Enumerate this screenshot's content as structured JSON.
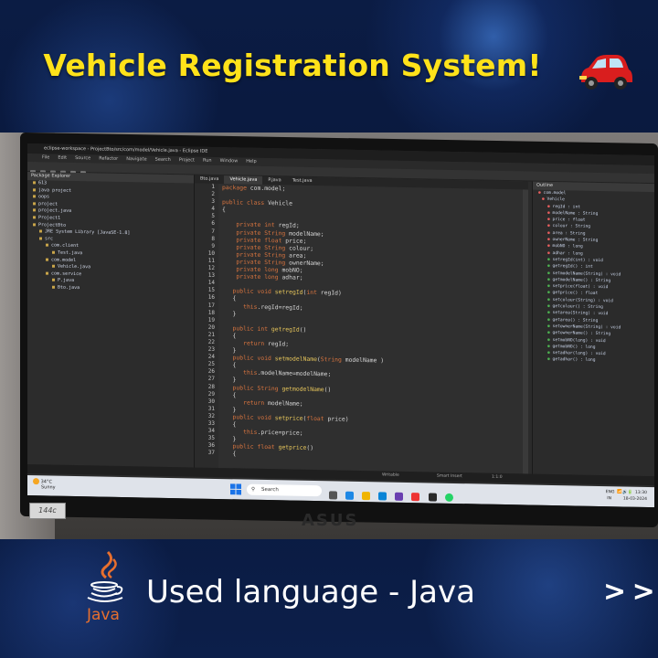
{
  "header": {
    "title": "Vehicle Registration System!",
    "emoji_icon": "car-icon"
  },
  "window": {
    "title": "eclipse-workspace - ProjectBto/src/com/model/Vehicle.java - Eclipse IDE",
    "menus": [
      "File",
      "Edit",
      "Source",
      "Refactor",
      "Navigate",
      "Search",
      "Project",
      "Run",
      "Window",
      "Help"
    ]
  },
  "package_explorer": {
    "title": "Package Explorer",
    "items": [
      "613",
      "java project",
      "oops",
      "project",
      "project.java",
      "Project1",
      "ProjectBto",
      "JRE System Library [JavaSE-1.8]",
      "src",
      "com.client",
      "Test.java",
      "com.model",
      "Vehicle.java",
      "com.service",
      "P.java",
      "Bto.java"
    ]
  },
  "editor": {
    "tabs": [
      "Bto.java",
      "Vehicle.java",
      "P.java",
      "Test.java"
    ],
    "active_tab": "Vehicle.java",
    "line_numbers": [
      "1",
      "2",
      "3",
      "4",
      "5",
      "6",
      "7",
      "8",
      "9",
      "10",
      "11",
      "12",
      "13",
      "14",
      "15",
      "16",
      "17",
      "18",
      "19",
      "20",
      "21",
      "22",
      "23",
      "24",
      "25",
      "26",
      "27",
      "28",
      "29",
      "30",
      "31",
      "32",
      "33",
      "34",
      "35",
      "36",
      "37"
    ],
    "lines": [
      "package com.model;",
      "",
      "public class Vehicle",
      "{",
      "",
      "    private int regId;",
      "    private String modelName;",
      "    private float price;",
      "    private String colour;",
      "    private String area;",
      "    private String ownerName;",
      "    private long mobNO;",
      "    private long adhar;",
      "",
      "   public void setregId(int regId)",
      "   {",
      "      this.regId=regId;",
      "   }",
      "",
      "   public int getregId()",
      "   {",
      "      return regId;",
      "   }",
      "   public void setmodelName(String modelName )",
      "   {",
      "      this.modelName=modelName;",
      "   }",
      "   public String getmodelName()",
      "   {",
      "      return modelName;",
      "   }",
      "   public void setprice(float price)",
      "   {",
      "      this.price=price;",
      "   }",
      "   public float getprice()",
      "   {"
    ]
  },
  "outline": {
    "title": "Outline",
    "items": [
      "com.model",
      "Vehicle",
      "regId : int",
      "modelName : String",
      "price : float",
      "colour : String",
      "area : String",
      "ownerName : String",
      "mobNO : long",
      "adhar : long",
      "setregId(int) : void",
      "getregId() : int",
      "setmodelName(String) : void",
      "getmodelName() : String",
      "setprice(float) : void",
      "getprice() : float",
      "setcolour(String) : void",
      "getcolour() : String",
      "setarea(String) : void",
      "getarea() : String",
      "setownerName(String) : void",
      "getownerName() : String",
      "setmobNO(long) : void",
      "getmobNO() : long",
      "setadhar(long) : void",
      "getadhar() : long"
    ]
  },
  "statusbar": {
    "mode": "Writable",
    "insert": "Smart Insert",
    "position": "1:1:0"
  },
  "taskbar": {
    "weather_temp": "34°C",
    "weather_desc": "Sunny",
    "search_placeholder": "Search",
    "lang": "ENG",
    "region": "IN",
    "time": "13:30",
    "date": "18-03-2024"
  },
  "laptop": {
    "brand": "ASUS",
    "sticker": "144c"
  },
  "footer": {
    "language_label": "Used language - Java",
    "logo_text": "Java",
    "next_label": "> >"
  },
  "colors": {
    "title_yellow": "#ffe21a",
    "background_navy": "#0a1a3c",
    "keyword": "#d8743f",
    "method": "#e7c65b"
  }
}
